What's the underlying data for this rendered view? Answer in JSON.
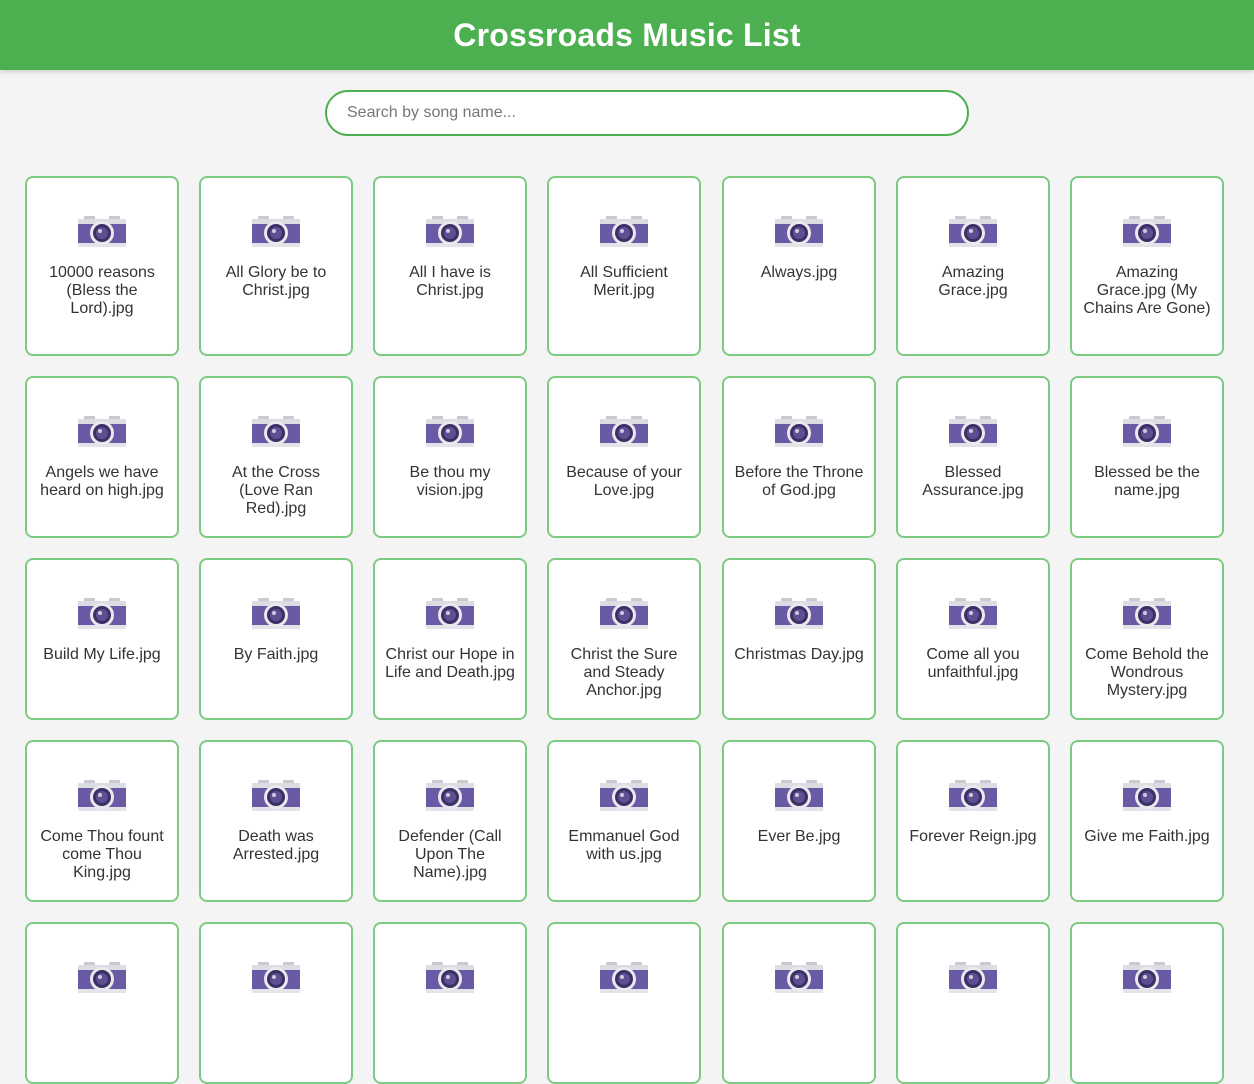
{
  "header": {
    "title": "Crossroads Music List"
  },
  "search": {
    "placeholder": "Search by song name..."
  },
  "colors": {
    "accent": "#4caf50",
    "card_border": "#7dcb80",
    "icon_body": "#6a5aa6"
  },
  "icon": "camera-icon",
  "songs": [
    "10000 reasons (Bless the Lord).jpg",
    "All Glory be to Christ.jpg",
    "All I have is Christ.jpg",
    "All Sufficient Merit.jpg",
    "Always.jpg",
    "Amazing Grace.jpg",
    "Amazing Grace.jpg (My Chains Are Gone)",
    "Angels we have heard on high.jpg",
    "At the Cross (Love Ran Red).jpg",
    "Be thou my vision.jpg",
    "Because of your Love.jpg",
    "Before the Throne of God.jpg",
    "Blessed Assurance.jpg",
    "Blessed be the name.jpg",
    "Build My Life.jpg",
    "By Faith.jpg",
    "Christ our Hope in Life and Death.jpg",
    "Christ the Sure and Steady Anchor.jpg",
    "Christmas Day.jpg",
    "Come all you unfaithful.jpg",
    "Come Behold the Wondrous Mystery.jpg",
    "Come Thou fount come Thou King.jpg",
    "Death was Arrested.jpg",
    "Defender (Call Upon The Name).jpg",
    "Emmanuel God with us.jpg",
    "Ever Be.jpg",
    "Forever Reign.jpg",
    "Give me Faith.jpg",
    "",
    "",
    "",
    "",
    "",
    "",
    ""
  ]
}
